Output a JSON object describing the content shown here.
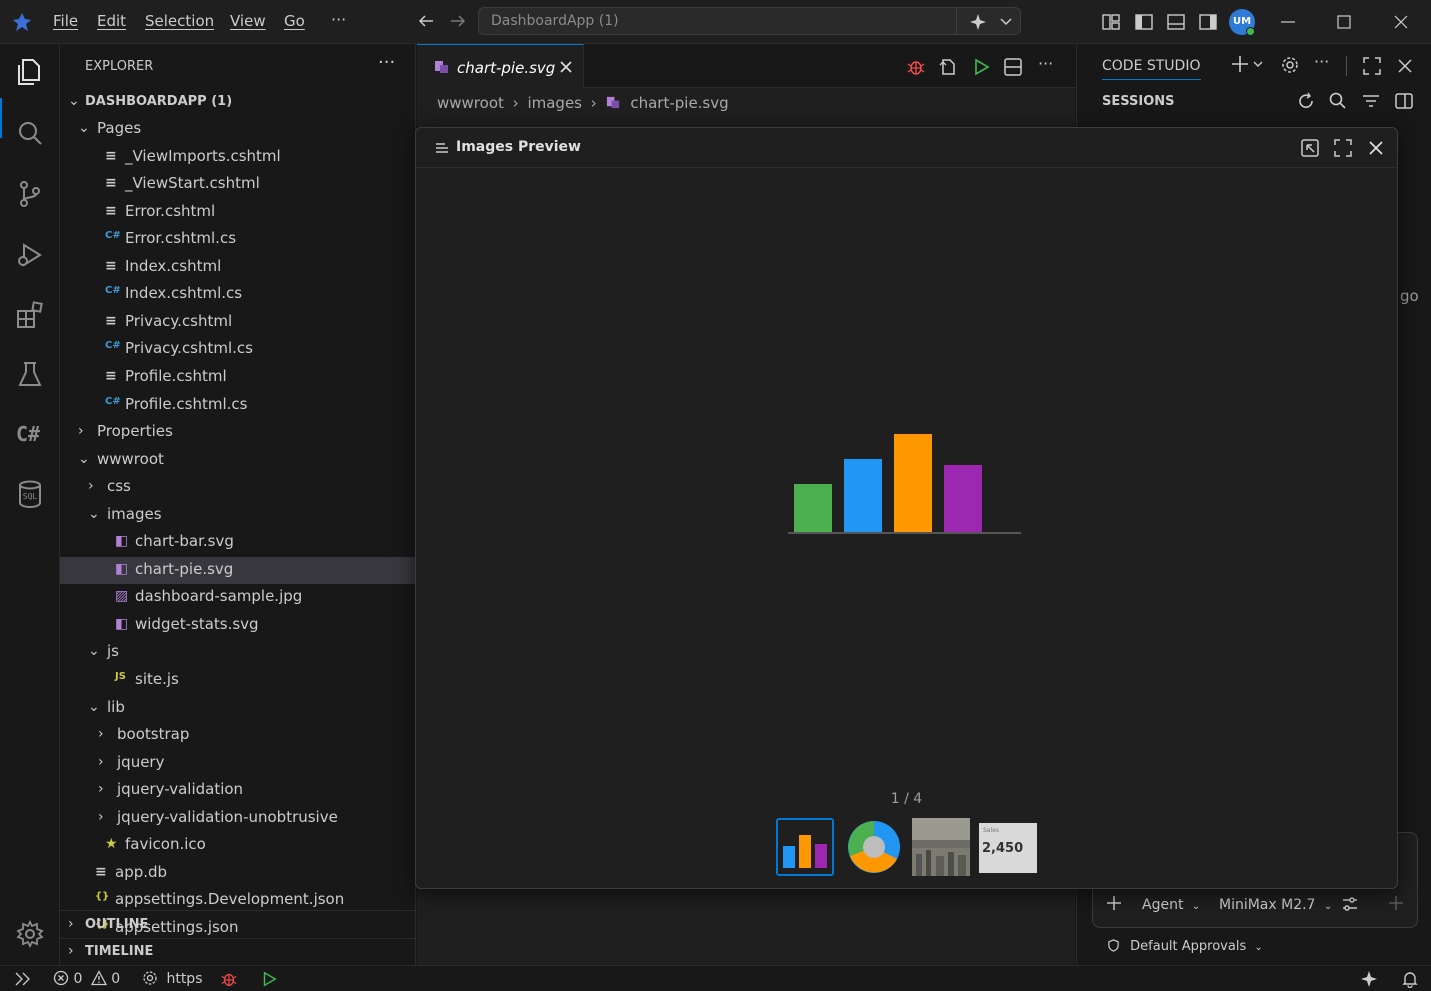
{
  "titlebar": {
    "menus": [
      "File",
      "Edit",
      "Selection",
      "View",
      "Go"
    ],
    "more": "···",
    "command_center": "DashboardApp (1)",
    "avatar_initials": "UM"
  },
  "sidebar": {
    "title": "EXPLORER",
    "more": "···",
    "root": "DASHBOARDAPP (1)",
    "tree": [
      {
        "label": "Pages",
        "depth": 0,
        "kind": "folder-open"
      },
      {
        "label": "_ViewImports.cshtml",
        "depth": 1,
        "kind": "razor"
      },
      {
        "label": "_ViewStart.cshtml",
        "depth": 1,
        "kind": "razor"
      },
      {
        "label": "Error.cshtml",
        "depth": 1,
        "kind": "razor"
      },
      {
        "label": "Error.cshtml.cs",
        "depth": 1,
        "kind": "cs"
      },
      {
        "label": "Index.cshtml",
        "depth": 1,
        "kind": "razor"
      },
      {
        "label": "Index.cshtml.cs",
        "depth": 1,
        "kind": "cs"
      },
      {
        "label": "Privacy.cshtml",
        "depth": 1,
        "kind": "razor"
      },
      {
        "label": "Privacy.cshtml.cs",
        "depth": 1,
        "kind": "cs"
      },
      {
        "label": "Profile.cshtml",
        "depth": 1,
        "kind": "razor"
      },
      {
        "label": "Profile.cshtml.cs",
        "depth": 1,
        "kind": "cs"
      },
      {
        "label": "Properties",
        "depth": 0,
        "kind": "folder"
      },
      {
        "label": "wwwroot",
        "depth": 0,
        "kind": "folder-open"
      },
      {
        "label": "css",
        "depth": 1,
        "kind": "folder"
      },
      {
        "label": "images",
        "depth": 1,
        "kind": "folder-open"
      },
      {
        "label": "chart-bar.svg",
        "depth": 2,
        "kind": "svg"
      },
      {
        "label": "chart-pie.svg",
        "depth": 2,
        "kind": "svg",
        "selected": true
      },
      {
        "label": "dashboard-sample.jpg",
        "depth": 2,
        "kind": "img"
      },
      {
        "label": "widget-stats.svg",
        "depth": 2,
        "kind": "svg"
      },
      {
        "label": "js",
        "depth": 1,
        "kind": "folder-open"
      },
      {
        "label": "site.js",
        "depth": 2,
        "kind": "js"
      },
      {
        "label": "lib",
        "depth": 1,
        "kind": "folder-open"
      },
      {
        "label": "bootstrap",
        "depth": 2,
        "kind": "folder"
      },
      {
        "label": "jquery",
        "depth": 2,
        "kind": "folder"
      },
      {
        "label": "jquery-validation",
        "depth": 2,
        "kind": "folder"
      },
      {
        "label": "jquery-validation-unobtrusive",
        "depth": 2,
        "kind": "folder"
      },
      {
        "label": "favicon.ico",
        "depth": 1,
        "kind": "star"
      },
      {
        "label": "app.db",
        "depth": 0,
        "kind": "db"
      },
      {
        "label": "appsettings.Development.json",
        "depth": 0,
        "kind": "json"
      },
      {
        "label": "appsettings.json",
        "depth": 0,
        "kind": "json"
      }
    ],
    "outline": "OUTLINE",
    "timeline": "TIMELINE"
  },
  "editor": {
    "tab_label": "chart-pie.svg",
    "breadcrumb": [
      "wwwroot",
      "images",
      "chart-pie.svg"
    ]
  },
  "modal": {
    "title": "Images Preview",
    "counter": "1 / 4",
    "bars": [
      {
        "value": 48,
        "color": "#4caf50"
      },
      {
        "value": 73,
        "color": "#2196f3"
      },
      {
        "value": 98,
        "color": "#ff9800"
      },
      {
        "value": 67,
        "color": "#9c27b0"
      }
    ],
    "thumb_sales_label": "Sales",
    "thumb_sales_value": "2,450"
  },
  "rightpanel": {
    "title": "CODE STUDIO",
    "sessions": "SESSIONS",
    "partial_text": "go",
    "agent": "Agent",
    "model": "MiniMax M2.7",
    "approvals": "Default Approvals"
  },
  "statusbar": {
    "errors": "0",
    "warnings": "0",
    "https": "https"
  }
}
